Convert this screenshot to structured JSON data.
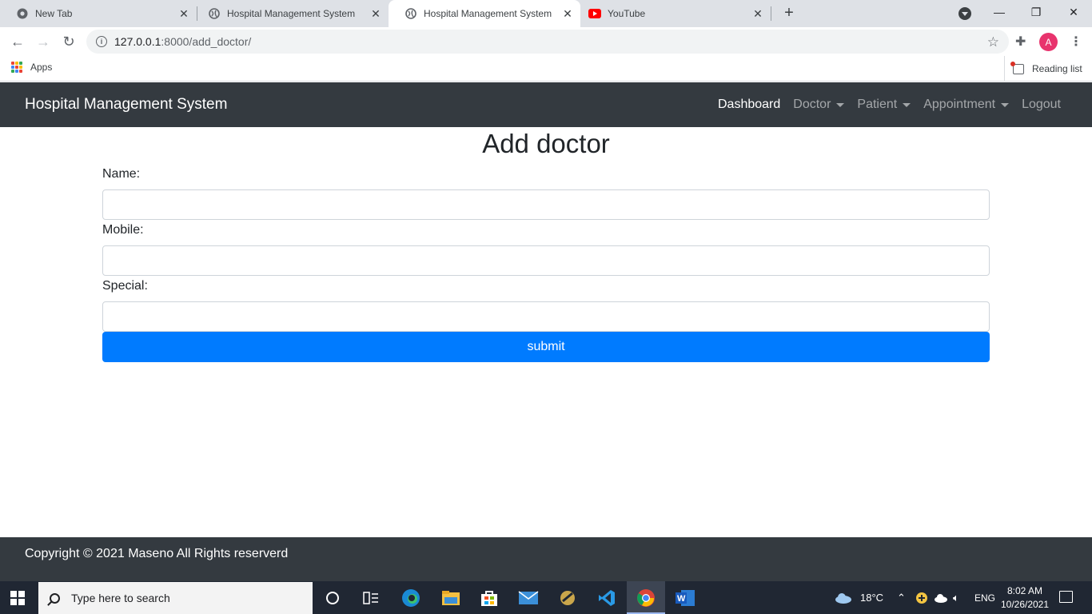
{
  "browser": {
    "tabs": [
      {
        "title": "New Tab",
        "active": false,
        "icon": "chrome-icon"
      },
      {
        "title": "Hospital Management System",
        "active": false,
        "icon": "globe-icon"
      },
      {
        "title": "Hospital Management System",
        "active": true,
        "icon": "globe-icon"
      },
      {
        "title": "YouTube",
        "active": false,
        "icon": "youtube-icon"
      }
    ],
    "new_tab_glyph": "+",
    "url_host": "127.0.0.1",
    "url_path": ":8000/add_doctor/",
    "profile_initial": "A",
    "bookmarks": {
      "apps_label": "Apps",
      "reading_list_label": "Reading list"
    },
    "colors": {
      "profile": "#e8336d",
      "tabstrip": "#dee1e6"
    }
  },
  "navbar": {
    "brand": "Hospital Management System",
    "links": [
      {
        "label": "Dashboard",
        "active": true,
        "dropdown": false
      },
      {
        "label": "Doctor",
        "active": false,
        "dropdown": true
      },
      {
        "label": "Patient",
        "active": false,
        "dropdown": true
      },
      {
        "label": "Appointment",
        "active": false,
        "dropdown": true
      },
      {
        "label": "Logout",
        "active": false,
        "dropdown": false
      }
    ]
  },
  "form": {
    "heading": "Add doctor",
    "fields": [
      {
        "label": "Name:",
        "value": ""
      },
      {
        "label": "Mobile:",
        "value": ""
      },
      {
        "label": "Special:",
        "value": ""
      }
    ],
    "submit_label": "submit",
    "submit_color": "#007bff"
  },
  "footer": {
    "text": "Copyright © 2021 Maseno All Rights reserverd"
  },
  "taskbar": {
    "search_placeholder": "Type here to search",
    "pinned_apps": [
      "cortana-icon",
      "task-view-icon",
      "edge-icon",
      "file-explorer-icon",
      "store-icon",
      "mail-icon",
      "app-icon",
      "vscode-icon",
      "chrome-icon",
      "word-icon"
    ],
    "active_app": "chrome-icon",
    "weather": "18°C",
    "language": "ENG",
    "time": "8:02 AM",
    "date": "10/26/2021"
  }
}
